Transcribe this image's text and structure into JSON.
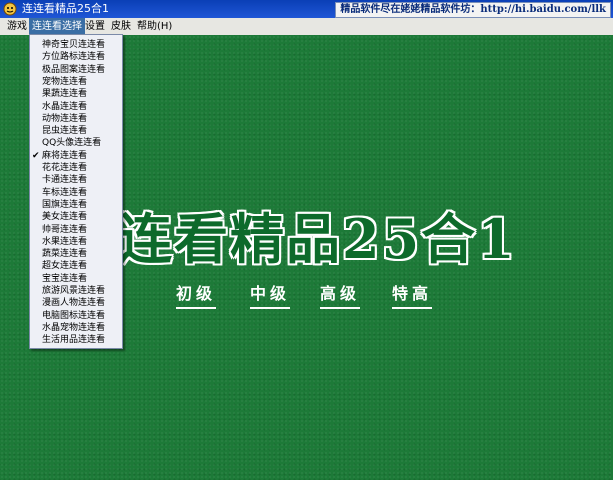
{
  "window": {
    "title": "连连看精品25合1",
    "link_text": "精品软件尽在姥姥精品软件坊：http://hi.baidu.com/llk"
  },
  "menubar": {
    "items": [
      "游戏",
      "连连看选择",
      "设置",
      "皮肤",
      "帮助(H)"
    ]
  },
  "dropdown": {
    "checked_index": 10,
    "items": [
      "神奇宝贝连连看",
      "方位路标连连看",
      "极品图案连连看",
      "宠物连连看",
      "果蔬连连看",
      "水晶连连看",
      "动物连连看",
      "昆虫连连看",
      "QQ头像连连看",
      "麻将连连看",
      "花花连连看",
      "卡通连连看",
      "车标连连看",
      "国旗连连看",
      "美女连连看",
      "帅哥连连看",
      "水果连连看",
      "蔬菜连连看",
      "超女连连看",
      "宝宝连连看",
      "旅游风景连连看",
      "漫画人物连连看",
      "电脑图标连连看",
      "水晶宠物连连看",
      "生活用品连连看"
    ]
  },
  "main": {
    "big_title": "连看精品25合1",
    "levels": [
      "初级",
      "中级",
      "高级",
      "特高"
    ]
  },
  "colors": {
    "background": "#1d7a38",
    "titlebar": "#0a3fb6"
  }
}
